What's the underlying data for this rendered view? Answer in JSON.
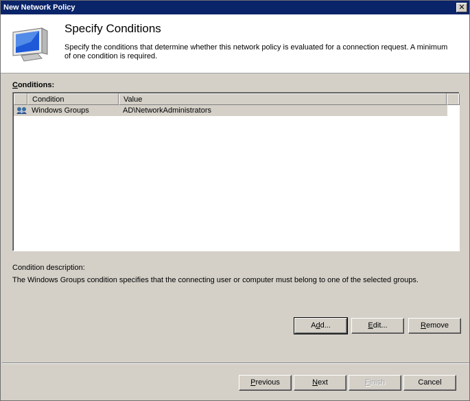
{
  "window": {
    "title": "New Network Policy",
    "close_glyph": "✕"
  },
  "header": {
    "title": "Specify Conditions",
    "description": "Specify the conditions that determine whether this network policy is evaluated for a connection request. A minimum of one condition is required.",
    "icon": "computer-monitor-icon"
  },
  "conditions": {
    "label_access_key": "C",
    "label_rest": "onditions:",
    "columns": [
      "Condition",
      "Value"
    ],
    "rows": [
      {
        "icon": "windows-groups-icon",
        "condition": "Windows Groups",
        "value": "AD\\NetworkAdministrators"
      }
    ]
  },
  "description": {
    "label": "Condition description:",
    "text": "The Windows Groups condition specifies that the connecting user or computer must belong to one of the selected groups."
  },
  "actions": {
    "add": {
      "key": "d",
      "pre": "A",
      "post": "d..."
    },
    "edit": {
      "key": "E",
      "pre": "",
      "post": "dit..."
    },
    "remove": {
      "key": "R",
      "pre": "",
      "post": "emove"
    }
  },
  "footer": {
    "previous": {
      "key": "P",
      "pre": "",
      "post": "revious"
    },
    "next": {
      "key": "N",
      "pre": "",
      "post": "ext"
    },
    "finish": {
      "key": "F",
      "pre": "",
      "post": "inish"
    },
    "cancel": "Cancel"
  }
}
